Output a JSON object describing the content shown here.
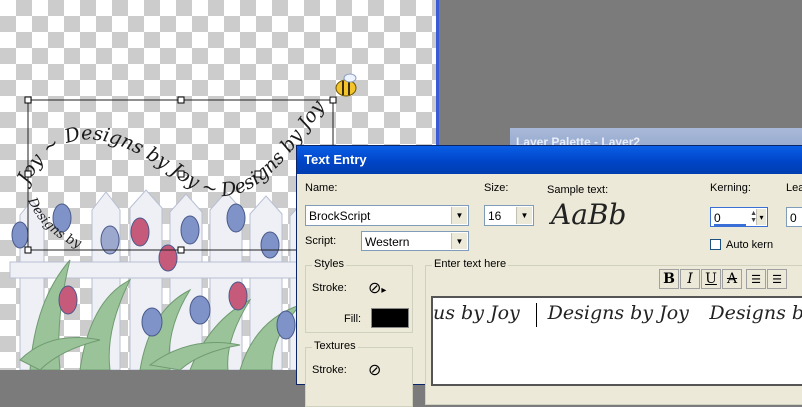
{
  "canvas": {
    "arc_top": "Joy ~ Designs by Joy ~ Designs by Joy",
    "arc_bottom": "Designs by"
  },
  "layer_palette": {
    "title": "Layer Palette - Layer2"
  },
  "dialog": {
    "title": "Text Entry",
    "name_label": "Name:",
    "name_value": "BrockScript",
    "size_label": "Size:",
    "size_value": "16",
    "sample_label": "Sample text:",
    "sample_text": "AaBb",
    "kerning_label": "Kerning:",
    "kerning_value": "0",
    "leading_label": "Lea",
    "leading_value": "0",
    "auto_kern_label": "Auto kern",
    "script_label": "Script:",
    "script_value": "Western",
    "styles_group": "Styles",
    "stroke_label": "Stroke:",
    "fill_label": "Fill:",
    "textures_group": "Textures",
    "textures_stroke_label": "Stroke:",
    "enter_text_label": "Enter text here",
    "format_buttons": {
      "bold": "B",
      "italic": "I",
      "underline": "U",
      "strike": "A"
    },
    "text_content": [
      "us by Joy",
      "Designs by Joy",
      "Designs by"
    ],
    "fill_color": "#000000"
  }
}
